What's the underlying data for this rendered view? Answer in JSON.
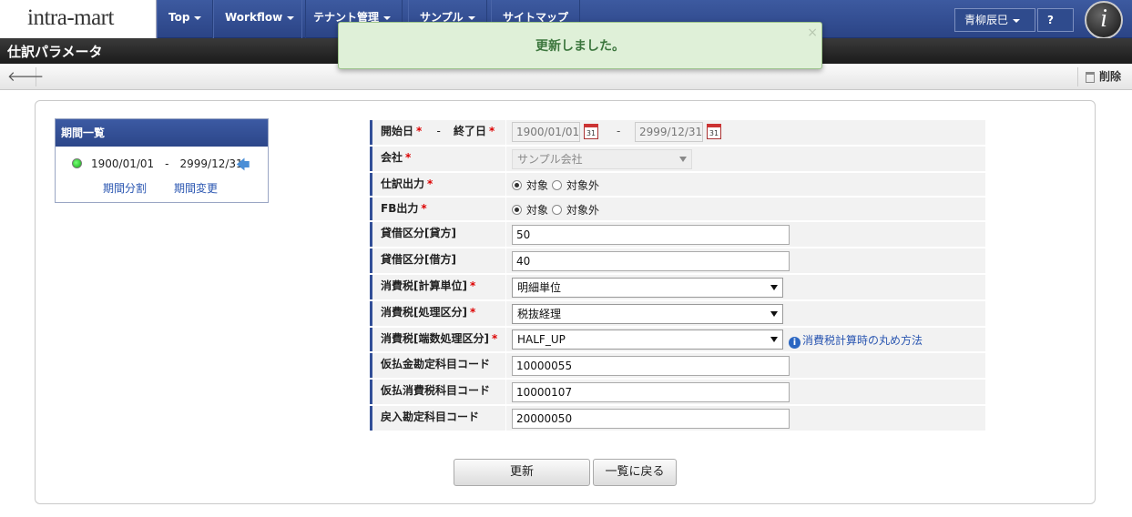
{
  "nav": {
    "logo": "intra-mart",
    "items": [
      {
        "label": "Top"
      },
      {
        "label": "Workflow"
      },
      {
        "label": "テナント管理"
      },
      {
        "label": "サンプル"
      },
      {
        "label": "サイトマップ"
      }
    ],
    "user": "青柳辰巳",
    "help": "?",
    "user_icon": "i"
  },
  "title": "仕訳パラメータ",
  "toolbar": {
    "delete_label": "削除"
  },
  "toast": {
    "message": "更新しました。",
    "close": "×"
  },
  "period_list": {
    "heading": "期間一覧",
    "range": "1900/01/01　-　2999/12/31",
    "split_link": "期間分割",
    "change_link": "期間変更"
  },
  "form": {
    "start_label": "開始日",
    "dash": "-",
    "end_label": "終了日",
    "start_date": "1900/01/01",
    "end_date": "2999/12/31",
    "cal_day": "31",
    "company_label": "会社",
    "company_value": "サンプル会社",
    "journal_label": "仕訳出力",
    "fb_label": "FB出力",
    "radio_target": "対象",
    "radio_nontarget": "対象外",
    "credit_label": "貸借区分[貸方]",
    "credit_value": "50",
    "debit_label": "貸借区分[借方]",
    "debit_value": "40",
    "tax_unit_label": "消費税[計算単位]",
    "tax_unit_value": "明細単位",
    "tax_proc_label": "消費税[処理区分]",
    "tax_proc_value": "税抜経理",
    "tax_round_label": "消費税[端数処理区分]",
    "tax_round_value": "HALF_UP",
    "tax_round_help": "消費税計算時の丸め方法",
    "prepaid_label": "仮払金勘定科目コード",
    "prepaid_value": "10000055",
    "prepaid_tax_label": "仮払消費税科目コード",
    "prepaid_tax_value": "10000107",
    "refund_label": "戻入勘定科目コード",
    "refund_value": "20000050",
    "required_mark": "*"
  },
  "buttons": {
    "update": "更新",
    "back_to_list": "一覧に戻る"
  }
}
